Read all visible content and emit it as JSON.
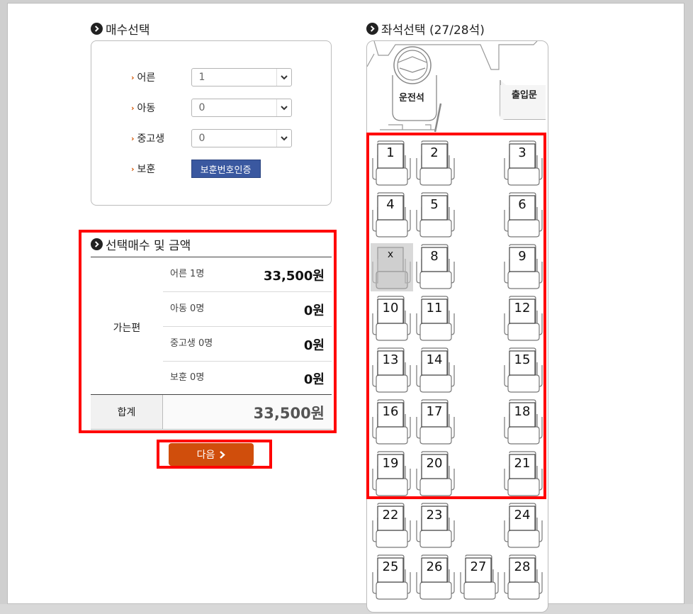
{
  "ticket": {
    "title": "매수선택",
    "rows": [
      {
        "label": "어른",
        "value": "1"
      },
      {
        "label": "아동",
        "value": "0"
      },
      {
        "label": "중고생",
        "value": "0"
      }
    ],
    "veteran_label": "보훈",
    "veteran_button": "보훈번호인증"
  },
  "summary": {
    "title": "선택매수 및 금액",
    "direction": "가는편",
    "items": [
      {
        "name": "어른 1명",
        "amount": "33,500원"
      },
      {
        "name": "아동 0명",
        "amount": "0원"
      },
      {
        "name": "중고생 0명",
        "amount": "0원"
      },
      {
        "name": "보훈 0명",
        "amount": "0원"
      }
    ],
    "total_label": "합계",
    "total_value": "33,500원"
  },
  "next_button": "다음",
  "seating": {
    "title": "좌석선택 (27/28석)",
    "driver_label": "운전석",
    "door_label": "출입문",
    "seats": [
      "1",
      "2",
      "3",
      "4",
      "5",
      "6",
      "X",
      "8",
      "9",
      "10",
      "11",
      "12",
      "13",
      "14",
      "15",
      "16",
      "17",
      "18",
      "19",
      "20",
      "21",
      "22",
      "23",
      "24",
      "25",
      "26",
      "27",
      "28"
    ],
    "taken_seat": "X"
  },
  "colors": {
    "accent": "#d04e0c",
    "verify": "#3a58a0",
    "highlight": "#ff0000"
  }
}
